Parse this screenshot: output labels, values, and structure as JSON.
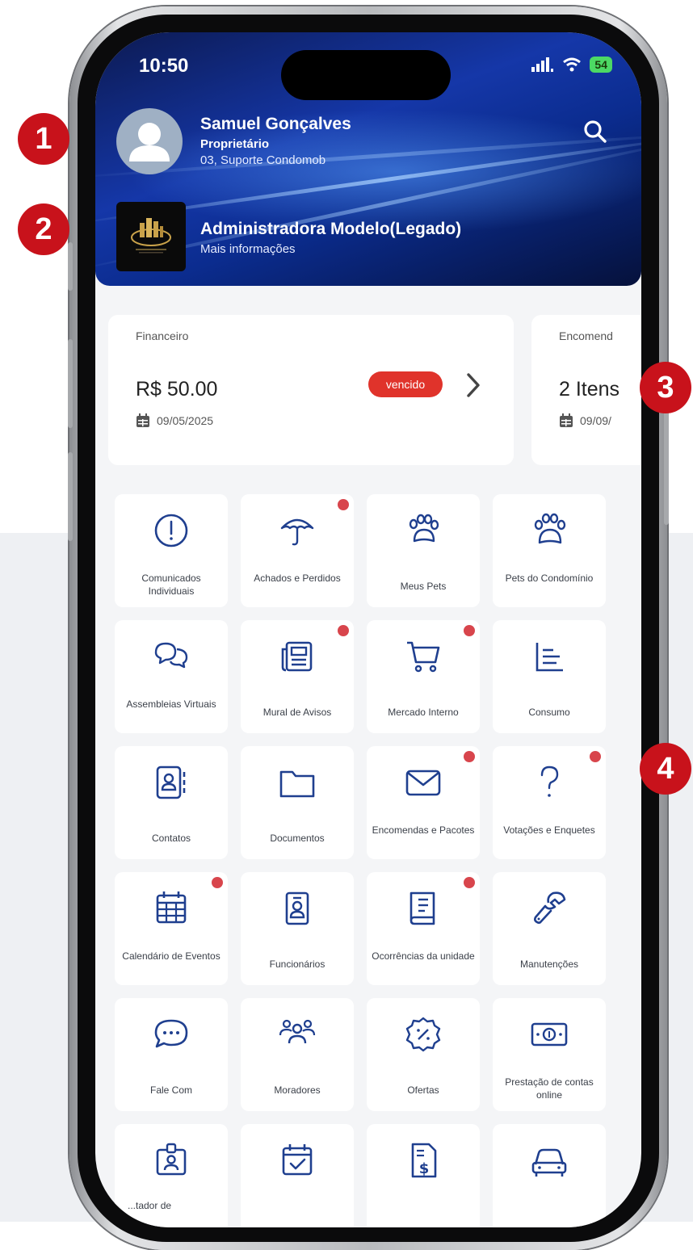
{
  "status_bar": {
    "time": "10:50",
    "battery": "54"
  },
  "user": {
    "name": "Samuel Gonçalves",
    "role": "Proprietário",
    "unit": "03, Suporte Condomob"
  },
  "admin": {
    "name": "Administradora Modelo(Legado)",
    "more": "Mais informações"
  },
  "cards": {
    "financeiro": {
      "label": "Financeiro",
      "value": "R$ 50.00",
      "status": "vencido",
      "date": "09/05/2025"
    },
    "encomendas": {
      "label": "Encomend",
      "value": "2 Itens",
      "date": "09/09/"
    }
  },
  "menu": [
    {
      "label": "Comunicados Individuais",
      "icon": "exclamation-circle-icon"
    },
    {
      "label": "Achados e Perdidos",
      "icon": "umbrella-icon",
      "notification": true
    },
    {
      "label": "Meus Pets",
      "icon": "paw-icon"
    },
    {
      "label": "Pets do Condomínio",
      "icon": "paw-outline-icon"
    },
    {
      "label": "Assembleias Virtuais",
      "icon": "chat-bubbles-icon"
    },
    {
      "label": "Mural de Avisos",
      "icon": "newspaper-icon",
      "notification": true
    },
    {
      "label": "Mercado Interno",
      "icon": "cart-icon",
      "notification": true
    },
    {
      "label": "Consumo",
      "icon": "chart-lines-icon"
    },
    {
      "label": "Contatos",
      "icon": "contacts-book-icon"
    },
    {
      "label": "Documentos",
      "icon": "folder-icon"
    },
    {
      "label": "Encomendas e Pacotes",
      "icon": "envelope-icon",
      "notification": true
    },
    {
      "label": "Votações e Enquetes",
      "icon": "question-icon",
      "notification": true
    },
    {
      "label": "Calendário de Eventos",
      "icon": "calendar-icon",
      "notification": true
    },
    {
      "label": "Funcionários",
      "icon": "id-badge-icon"
    },
    {
      "label": "Ocorrências da unidade",
      "icon": "book-icon",
      "notification": true
    },
    {
      "label": "Manutenções",
      "icon": "wrench-icon"
    },
    {
      "label": "Fale Com",
      "icon": "chat-dots-icon"
    },
    {
      "label": "Moradores",
      "icon": "people-icon"
    },
    {
      "label": "Ofertas",
      "icon": "discount-badge-icon"
    },
    {
      "label": "Prestação de contas online",
      "icon": "banknote-icon"
    },
    {
      "label": "",
      "icon": "visitor-badge-icon"
    },
    {
      "label": "",
      "icon": "calendar-check-icon"
    },
    {
      "label": "",
      "icon": "invoice-icon"
    },
    {
      "label": "",
      "icon": "car-icon"
    }
  ],
  "partial_label": "...tador de",
  "callouts": [
    "1",
    "2",
    "3",
    "4"
  ],
  "colors": {
    "accent": "#1e3a8a",
    "icon": "#1f3f8f",
    "alert": "#e0332b",
    "dot": "#d8454c",
    "callout": "#c8121b"
  }
}
